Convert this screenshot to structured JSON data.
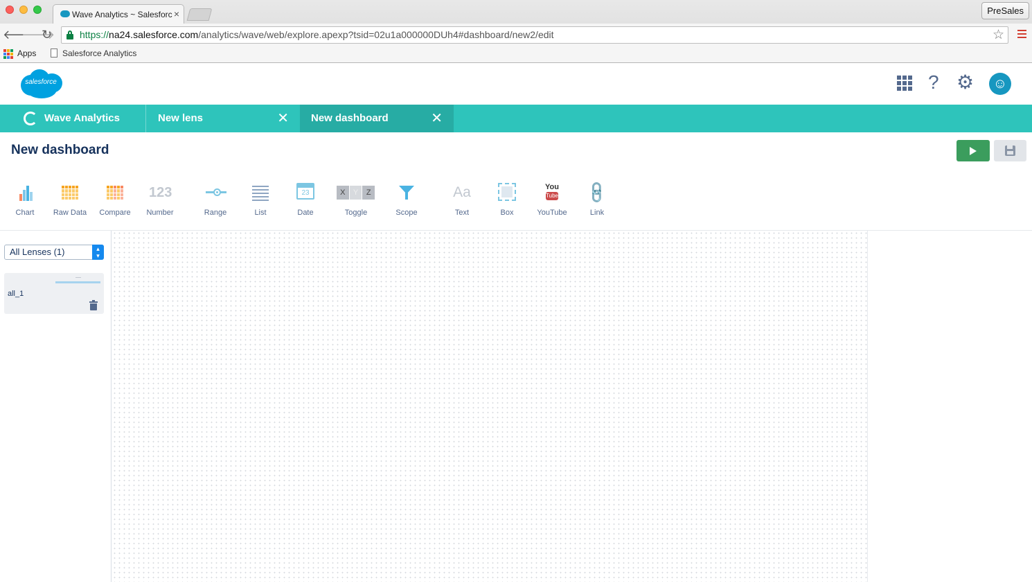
{
  "browser": {
    "tab_title": "Wave Analytics ~ Salesforce",
    "tab_close": "×",
    "profile": "PreSales",
    "url_scheme": "https://",
    "url_host": "na24.salesforce.com",
    "url_path": "/analytics/wave/web/explore.apexp?tsid=02u1a000000DUh4#dashboard/new2/edit",
    "bookmarks": [
      "Apps",
      "Salesforce Analytics"
    ]
  },
  "header": {
    "logo_text": "salesforce",
    "help_glyph": "?",
    "settings_glyph": "⚙",
    "avatar_glyph": "☺"
  },
  "app_tabs": [
    {
      "label": "Wave Analytics"
    },
    {
      "label": "New lens",
      "close": "✕"
    },
    {
      "label": "New dashboard",
      "close": "✕",
      "active": true
    }
  ],
  "page": {
    "title": "New dashboard"
  },
  "palette": [
    {
      "label": "Chart",
      "icon": "bar-chart-icon"
    },
    {
      "label": "Raw Data",
      "icon": "table-grid-icon"
    },
    {
      "label": "Compare",
      "icon": "compare-table-icon"
    },
    {
      "label": "Number",
      "icon": "number-icon",
      "glyph": "123"
    },
    {
      "label": "Range",
      "icon": "slider-icon"
    },
    {
      "label": "List",
      "icon": "list-icon"
    },
    {
      "label": "Date",
      "icon": "calendar-icon",
      "glyph": "23"
    },
    {
      "label": "Toggle",
      "icon": "toggle-icon",
      "glyphs": [
        "X",
        "Y",
        "Z"
      ]
    },
    {
      "label": "Scope",
      "icon": "funnel-icon"
    },
    {
      "label": "Text",
      "icon": "text-icon",
      "glyph": "Aa"
    },
    {
      "label": "Box",
      "icon": "box-icon"
    },
    {
      "label": "YouTube",
      "icon": "youtube-icon",
      "glyphs": [
        "You",
        "Tube"
      ]
    },
    {
      "label": "Link",
      "icon": "link-icon",
      "glyph": "🔗"
    }
  ],
  "lens_panel": {
    "select_value": "All Lenses (1)",
    "lenses": [
      {
        "name": "all_1"
      }
    ]
  },
  "colors": {
    "app_bar": "#2ec4bb",
    "active_tab": "#27aca4",
    "run_button": "#3b9d5d",
    "brand": "#00a1e0"
  }
}
